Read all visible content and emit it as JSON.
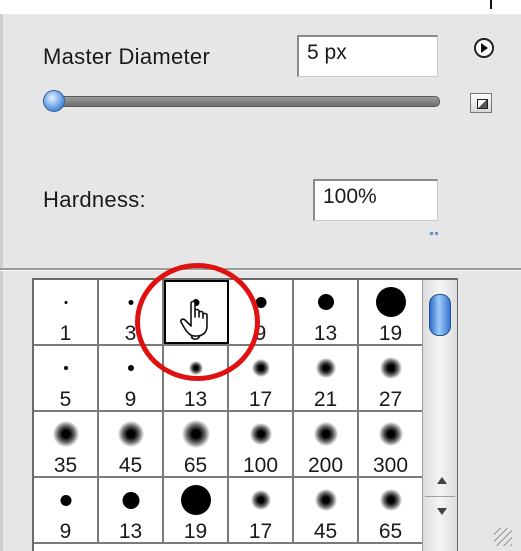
{
  "brush_panel": {
    "master_diameter": {
      "label": "Master Diameter",
      "value": "5 px"
    },
    "hardness": {
      "label": "Hardness:",
      "value": "100%"
    },
    "icons": {
      "menu": "play-circle-icon",
      "new_preset": "new-preset-icon"
    }
  },
  "brush_presets": {
    "rows": [
      [
        {
          "label": "1",
          "size": 3,
          "type": "hard"
        },
        {
          "label": "3",
          "size": 5,
          "type": "hard"
        },
        {
          "label": "5",
          "size": 7,
          "type": "hard",
          "selected": true
        },
        {
          "label": "9",
          "size": 11,
          "type": "hard"
        },
        {
          "label": "13",
          "size": 16,
          "type": "hard"
        },
        {
          "label": "19",
          "size": 30,
          "type": "hard"
        }
      ],
      [
        {
          "label": "5",
          "size": 4,
          "type": "hard"
        },
        {
          "label": "9",
          "size": 6,
          "type": "hard"
        },
        {
          "label": "13",
          "size": 14,
          "type": "soft"
        },
        {
          "label": "17",
          "size": 18,
          "type": "soft"
        },
        {
          "label": "21",
          "size": 20,
          "type": "soft"
        },
        {
          "label": "27",
          "size": 22,
          "type": "soft"
        }
      ],
      [
        {
          "label": "35",
          "size": 26,
          "type": "soft"
        },
        {
          "label": "45",
          "size": 26,
          "type": "soft"
        },
        {
          "label": "65",
          "size": 28,
          "type": "soft"
        },
        {
          "label": "100",
          "size": 22,
          "type": "soft"
        },
        {
          "label": "200",
          "size": 24,
          "type": "soft"
        },
        {
          "label": "300",
          "size": 24,
          "type": "soft"
        }
      ],
      [
        {
          "label": "9",
          "size": 11,
          "type": "hard"
        },
        {
          "label": "13",
          "size": 17,
          "type": "hard"
        },
        {
          "label": "19",
          "size": 30,
          "type": "hard"
        },
        {
          "label": "17",
          "size": 20,
          "type": "soft"
        },
        {
          "label": "45",
          "size": 22,
          "type": "soft"
        },
        {
          "label": "65",
          "size": 22,
          "type": "soft"
        }
      ]
    ]
  },
  "annotation": {
    "color": "#e01111",
    "cursor": "hand-pointer-icon"
  }
}
